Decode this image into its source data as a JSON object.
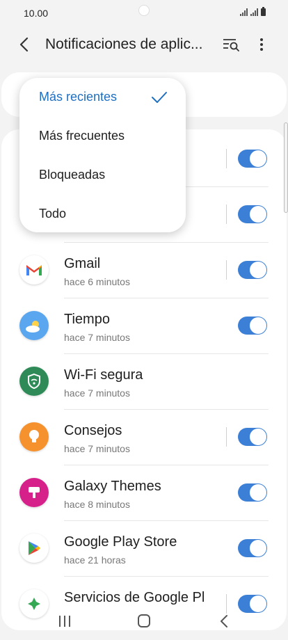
{
  "status_bar": {
    "time": "10.00"
  },
  "header": {
    "title": "Notificaciones de aplic..."
  },
  "menu": {
    "items": [
      {
        "label": "Más recientes",
        "selected": true
      },
      {
        "label": "Más frecuentes",
        "selected": false
      },
      {
        "label": "Bloqueadas",
        "selected": false
      },
      {
        "label": "Todo",
        "selected": false
      }
    ]
  },
  "apps": [
    {
      "name": "Gmail",
      "time": "hace 6 minutos",
      "icon": "gmail-icon",
      "enabled": true,
      "divider": true
    },
    {
      "name": "Tiempo",
      "time": "hace 7 minutos",
      "icon": "weather-icon",
      "enabled": true,
      "divider": false
    },
    {
      "name": "Wi-Fi segura",
      "time": "hace 7 minutos",
      "icon": "secure-wifi-icon",
      "enabled": false,
      "divider": false
    },
    {
      "name": "Consejos",
      "time": "hace 7 minutos",
      "icon": "tips-icon",
      "enabled": true,
      "divider": true
    },
    {
      "name": "Galaxy Themes",
      "time": "hace 8 minutos",
      "icon": "themes-icon",
      "enabled": true,
      "divider": false
    },
    {
      "name": "Google Play Store",
      "time": "hace 21 horas",
      "icon": "play-store-icon",
      "enabled": true,
      "divider": false
    },
    {
      "name": "Servicios de Google Pl",
      "time": "",
      "icon": "play-services-icon",
      "enabled": true,
      "divider": true
    }
  ],
  "colors": {
    "accent": "#3c7fd6",
    "selected_text": "#1f6fc0",
    "background": "#f3f3f3"
  }
}
